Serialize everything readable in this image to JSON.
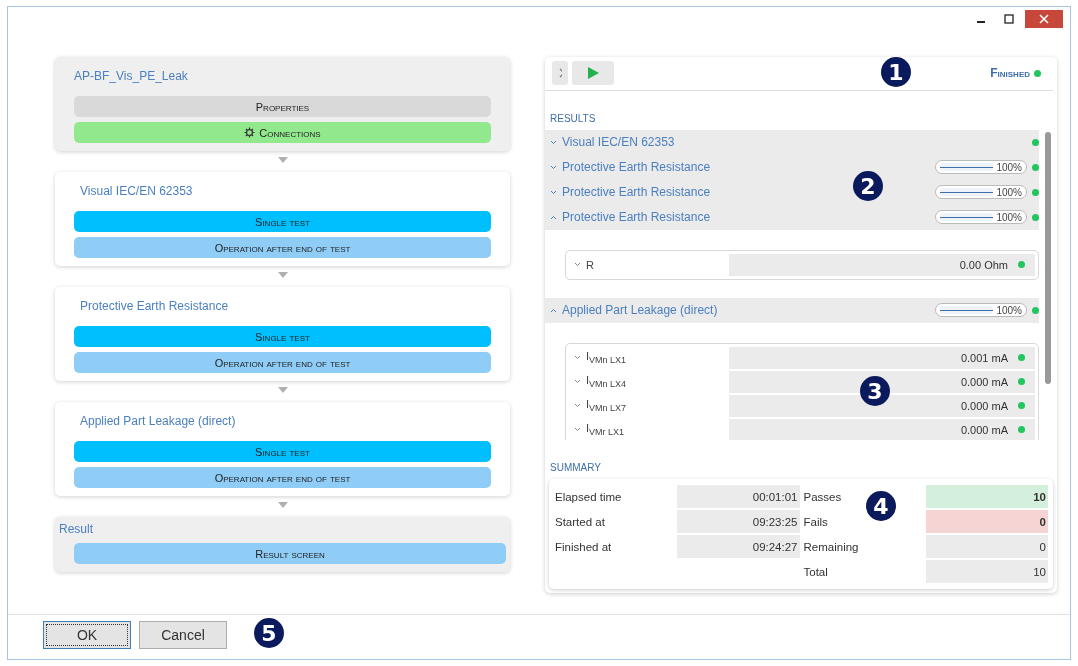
{
  "flow": [
    {
      "kind": "header",
      "title": "AP-BF_Vis_PE_Leak",
      "buttons": [
        {
          "label": "Properties",
          "kind": "neutral"
        },
        {
          "label": "Connections",
          "kind": "connections"
        }
      ]
    },
    {
      "kind": "step",
      "title": "Visual IEC/EN 62353",
      "buttons": [
        {
          "label": "Single test",
          "kind": "primary"
        },
        {
          "label": "Operation after end of test",
          "kind": "secondary"
        }
      ]
    },
    {
      "kind": "step",
      "title": "Protective Earth Resistance",
      "buttons": [
        {
          "label": "Single test",
          "kind": "primary"
        },
        {
          "label": "Operation after end of test",
          "kind": "secondary"
        }
      ]
    },
    {
      "kind": "step",
      "title": "Applied Part Leakage (direct)",
      "buttons": [
        {
          "label": "Single test",
          "kind": "primary"
        },
        {
          "label": "Operation after end of test",
          "kind": "secondary"
        }
      ]
    },
    {
      "kind": "result",
      "title": "Result",
      "buttons": [
        {
          "label": "Result screen",
          "kind": "secondary"
        }
      ]
    }
  ],
  "run_panel": {
    "status": "Finished",
    "passed": true
  },
  "results": {
    "heading": "RESULTS",
    "groups": [
      {
        "title": "Visual IEC/EN 62353",
        "expanded": false,
        "passed": true
      },
      {
        "title": "Protective Earth Resistance",
        "expanded": false,
        "level": 1,
        "reading": "100%",
        "passed": true
      },
      {
        "title": "Protective Earth Resistance",
        "expanded": false,
        "level": 1,
        "reading": "100%",
        "passed": true
      },
      {
        "title": "Protective Earth Resistance",
        "expanded": true,
        "level": 1,
        "reading": "100%",
        "passed": true,
        "measurements": [
          {
            "label": "R",
            "expanded": false,
            "value": "0.00 Ohm",
            "passed": true
          }
        ]
      },
      {
        "title": "Applied Part Leakage (direct)",
        "expanded": true,
        "level": 1,
        "reading": "100%",
        "passed": true,
        "measurements": [
          {
            "label": "I$_{VMn LX1}$",
            "expanded": false,
            "value": "0.001 mA",
            "passed": true
          },
          {
            "label": "I$_{VMn LX4}$",
            "expanded": false,
            "value": "0.000 mA",
            "passed": true
          },
          {
            "label": "I$_{VMn LX7}$",
            "expanded": false,
            "value": "0.000 mA",
            "passed": true
          },
          {
            "label": "I$_{VMr LX1}$",
            "expanded": false,
            "value": "0.000 mA",
            "passed": true
          }
        ]
      }
    ]
  },
  "summary": {
    "heading": "SUMMARY",
    "left": [
      {
        "label": "Elapsed time",
        "value": "00:01:01"
      },
      {
        "label": "Started at",
        "value": "09:23:25"
      },
      {
        "label": "Finished at",
        "value": "09:24:27"
      }
    ],
    "right": [
      {
        "label": "Passes",
        "value": "10",
        "kind": "pass"
      },
      {
        "label": "Fails",
        "value": "0",
        "kind": "fail"
      },
      {
        "label": "Remaining",
        "value": "0",
        "kind": "plain"
      },
      {
        "label": "Total",
        "value": "10",
        "kind": "plain"
      }
    ]
  },
  "buttons": [
    {
      "label": "OK",
      "focused": true
    },
    {
      "label": "Cancel",
      "focused": false
    }
  ],
  "callouts": [
    "1",
    "2",
    "3",
    "4",
    "5"
  ]
}
